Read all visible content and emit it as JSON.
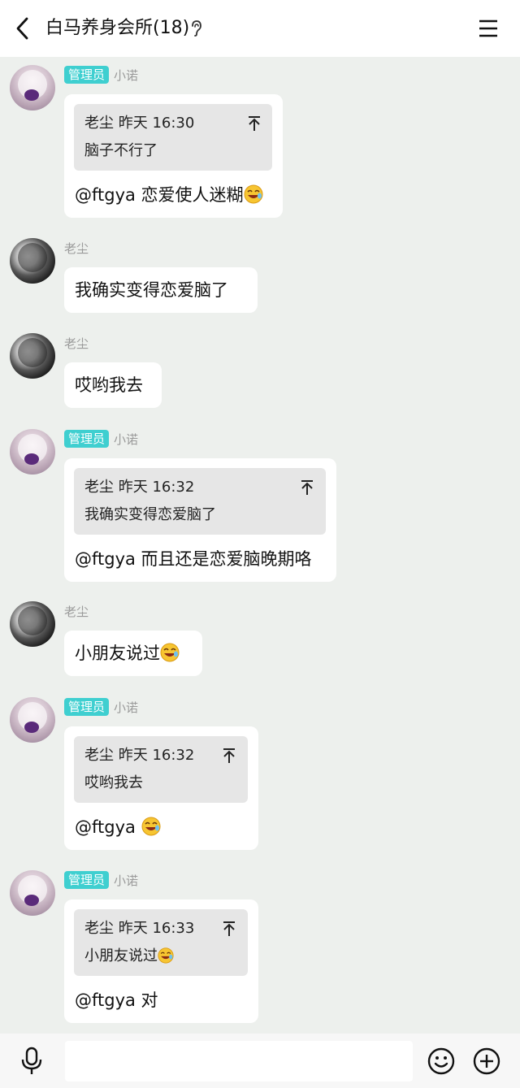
{
  "header": {
    "title": "白马养身会所(18)"
  },
  "colors": {
    "badge": "#3fcfd0",
    "chat_bg": "#edf0ed",
    "bubble": "#ffffff",
    "quote_bg": "#e6e6e6"
  },
  "icons": {
    "back": "chevron-left-icon",
    "ear": "ear-icon",
    "menu": "menu-icon",
    "pin": "pin-top-icon",
    "emoji": "laugh-emoji-icon",
    "mic": "microphone-icon",
    "smile": "smile-icon",
    "plus": "plus-circle-icon"
  },
  "messages": [
    {
      "badge": "管理员",
      "name": "小诺",
      "quote_head": "老尘  昨天 16:30",
      "quote_text": "脑子不行了",
      "reply": "@ftgya 恋爱使人迷糊"
    },
    {
      "name": "老尘",
      "text": "我确实变得恋爱脑了"
    },
    {
      "name": "老尘",
      "text": "哎哟我去"
    },
    {
      "badge": "管理员",
      "name": "小诺",
      "quote_head": "老尘  昨天 16:32",
      "quote_text": "我确实变得恋爱脑了",
      "reply": "@ftgya 而且还是恋爱脑晚期咯"
    },
    {
      "name": "老尘",
      "text": "小朋友说过"
    },
    {
      "badge": "管理员",
      "name": "小诺",
      "quote_head": "老尘  昨天 16:32",
      "quote_text": "哎哟我去",
      "reply": "@ftgya "
    },
    {
      "badge": "管理员",
      "name": "小诺",
      "quote_head": "老尘  昨天 16:33",
      "quote_text": "小朋友说过",
      "reply": "@ftgya 对"
    }
  ],
  "input": {
    "value": ""
  }
}
